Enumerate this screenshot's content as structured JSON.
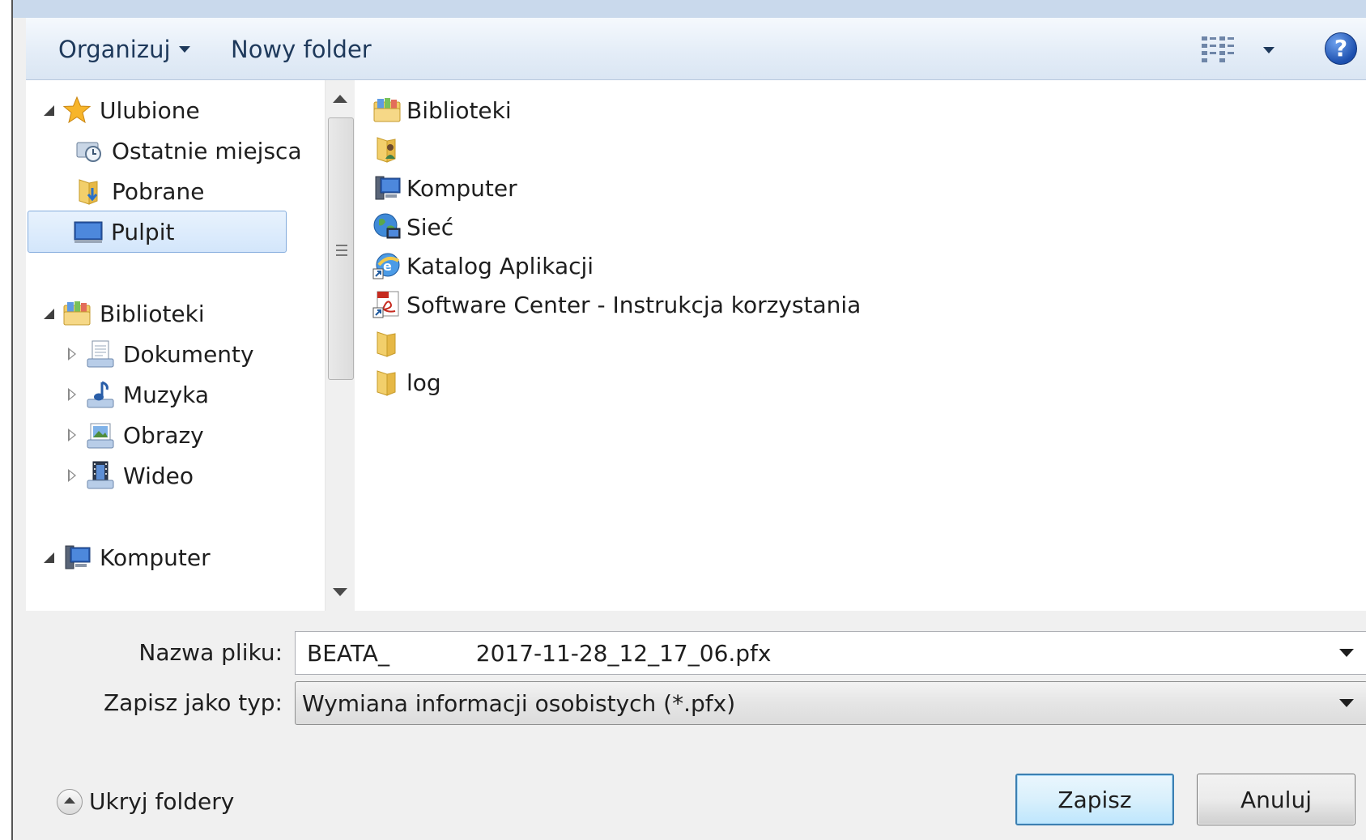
{
  "toolbar": {
    "organize_label": "Organizuj",
    "new_folder_label": "Nowy folder",
    "help_glyph": "?"
  },
  "nav": {
    "favorites": {
      "label": "Ulubione",
      "items": [
        {
          "label": "Ostatnie miejsca",
          "icon": "recent-places-icon"
        },
        {
          "label": "Pobrane",
          "icon": "downloads-folder-icon"
        },
        {
          "label": "Pulpit",
          "icon": "desktop-icon",
          "selected": true
        }
      ]
    },
    "libraries": {
      "label": "Biblioteki",
      "items": [
        {
          "label": "Dokumenty",
          "icon": "documents-icon"
        },
        {
          "label": "Muzyka",
          "icon": "music-icon"
        },
        {
          "label": "Obrazy",
          "icon": "pictures-icon"
        },
        {
          "label": "Wideo",
          "icon": "video-icon"
        }
      ]
    },
    "computer": {
      "label": "Komputer"
    }
  },
  "files": [
    {
      "label": "Biblioteki",
      "icon": "libraries-icon"
    },
    {
      "label": "",
      "icon": "user-folder-icon",
      "redacted": true
    },
    {
      "label": "Komputer",
      "icon": "computer-icon"
    },
    {
      "label": "Sieć",
      "icon": "network-icon"
    },
    {
      "label": "Katalog Aplikacji",
      "icon": "app-catalog-shortcut-icon"
    },
    {
      "label": "Software Center - Instrukcja korzystania",
      "icon": "pdf-shortcut-icon"
    },
    {
      "label": "",
      "icon": "folder-icon",
      "redacted": true
    },
    {
      "label": "log",
      "icon": "folder-icon"
    }
  ],
  "form": {
    "filename_label": "Nazwa pliku:",
    "filename_value": "BEATA_            2017-11-28_12_17_06.pfx",
    "filetype_label": "Zapisz jako typ:",
    "filetype_value": "Wymiana informacji osobistych (*.pfx)"
  },
  "buttons": {
    "save": "Zapisz",
    "cancel": "Anuluj",
    "hide_folders": "Ukryj foldery"
  },
  "colors": {
    "accent_blue": "#1e395b",
    "selection": "#d3e6fb",
    "primary_border": "#3c7fb1"
  }
}
